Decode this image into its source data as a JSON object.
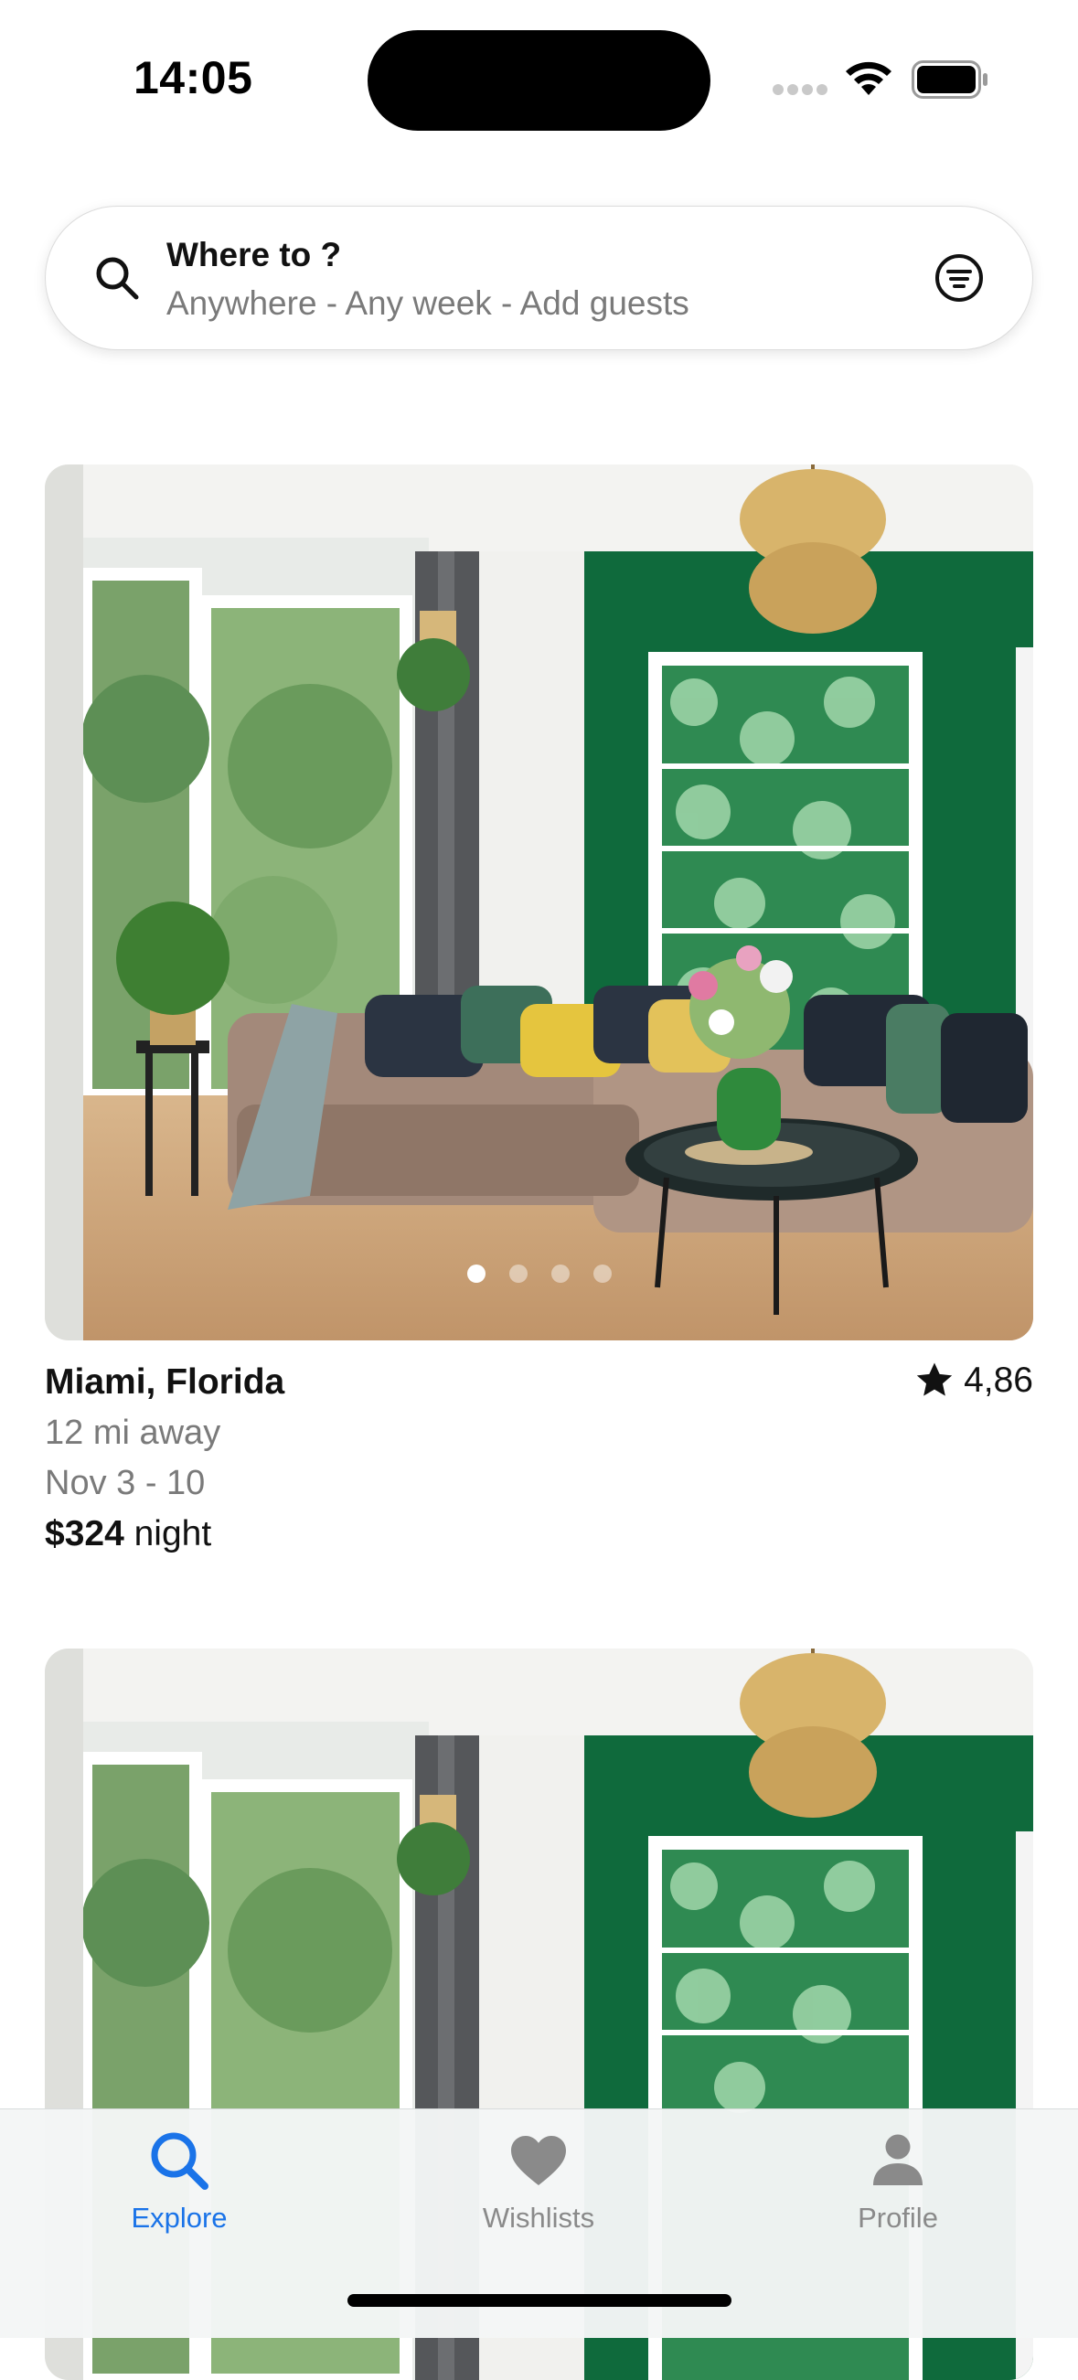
{
  "status_bar": {
    "time": "14:05"
  },
  "search": {
    "title": "Where to ?",
    "subtitle": "Anywhere - Any week - Add guests",
    "icon": "search-icon",
    "filter_icon": "filter-icon"
  },
  "listings": [
    {
      "location": "Miami, Florida",
      "rating": "4,86",
      "distance": "12 mi away",
      "dates": "Nov 3 - 10",
      "price": "$324",
      "price_unit": "night",
      "photo_count": 4,
      "active_photo": 1
    }
  ],
  "tabbar": {
    "items": [
      {
        "label": "Explore",
        "icon": "search-icon",
        "active": true
      },
      {
        "label": "Wishlists",
        "icon": "heart-icon",
        "active": false
      },
      {
        "label": "Profile",
        "icon": "person-icon",
        "active": false
      }
    ]
  },
  "colors": {
    "accent": "#1a73e8",
    "inactive": "#8a8a8a",
    "wall_green": "#0f6a3c",
    "text": "#111111",
    "secondary_text": "#7a7a7a"
  }
}
